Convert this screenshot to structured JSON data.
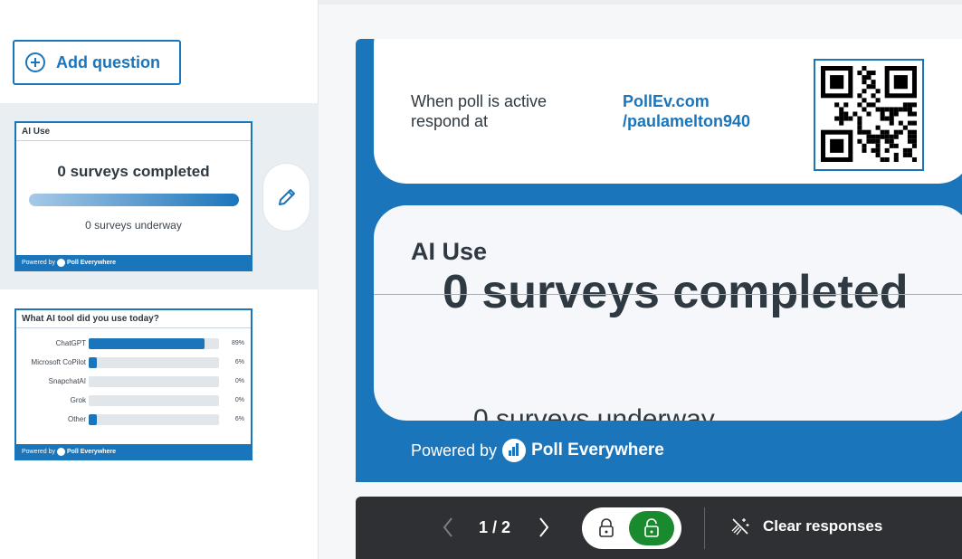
{
  "sidebar": {
    "add_question_label": "Add question",
    "slides": [
      {
        "title": "AI Use",
        "completed_text": "0 surveys completed",
        "underway_text": "0 surveys underway",
        "powered_text": "Powered by",
        "brand": "Poll Everywhere"
      },
      {
        "title": "What AI tool did you use today?",
        "powered_text": "Powered by",
        "brand": "Poll Everywhere",
        "options": [
          {
            "label": "ChatGPT",
            "percent_text": "89%",
            "value": 89
          },
          {
            "label": "Microsoft CoPilot",
            "percent_text": "6%",
            "value": 6
          },
          {
            "label": "SnapchatAI",
            "percent_text": "0%",
            "value": 0
          },
          {
            "label": "Grok",
            "percent_text": "0%",
            "value": 0
          },
          {
            "label": "Other",
            "percent_text": "6%",
            "value": 6
          }
        ]
      }
    ]
  },
  "slide": {
    "respond_line1": "When poll is active",
    "respond_line2": "respond at",
    "url_line1": "PollEv.com",
    "url_line2": "/paulamelton940",
    "question_title": "AI Use",
    "completed_text": "0 surveys completed",
    "underway_text": "0 surveys underway",
    "powered_text": "Powered by",
    "brand": "Poll Everywhere"
  },
  "toolbar": {
    "page_indicator": "1 / 2",
    "clear_label": "Clear responses"
  },
  "colors": {
    "accent": "#1b75bb",
    "active_green": "#1a8a2f",
    "toolbar_bg": "#2f3033"
  }
}
